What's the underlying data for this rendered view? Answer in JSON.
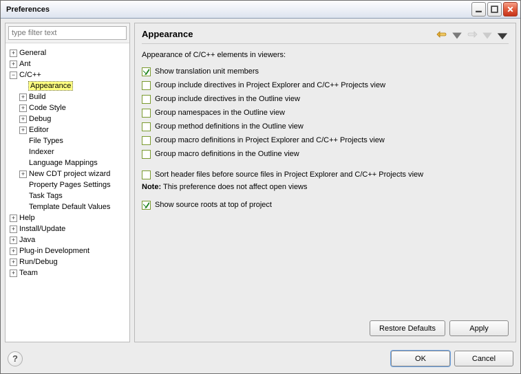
{
  "window": {
    "title": "Preferences"
  },
  "filter": {
    "placeholder": "type filter text"
  },
  "page": {
    "title": "Appearance",
    "description": "Appearance of C/C++ elements in viewers:",
    "noteLabel": "Note:",
    "noteText": "This preference does not affect open views"
  },
  "checkboxes": [
    {
      "label": "Show translation unit members",
      "checked": true
    },
    {
      "label": "Group include directives in Project Explorer and C/C++ Projects view",
      "checked": false
    },
    {
      "label": "Group include directives in the Outline view",
      "checked": false
    },
    {
      "label": "Group namespaces in the Outline view",
      "checked": false
    },
    {
      "label": "Group method definitions in the Outline view",
      "checked": false
    },
    {
      "label": "Group macro definitions in Project Explorer and C/C++ Projects view",
      "checked": false
    },
    {
      "label": "Group macro definitions in the Outline view",
      "checked": false
    }
  ],
  "sortHeader": {
    "label": "Sort header files before source files in Project Explorer and C/C++ Projects view",
    "checked": false
  },
  "showSourceRoots": {
    "label": "Show source roots at top of project",
    "checked": true
  },
  "buttons": {
    "restoreDefaults": "Restore Defaults",
    "apply": "Apply",
    "ok": "OK",
    "cancel": "Cancel",
    "help": "?"
  },
  "tree": {
    "general": "General",
    "ant": "Ant",
    "ccpp": "C/C++",
    "appearance": "Appearance",
    "build": "Build",
    "codeStyle": "Code Style",
    "debug": "Debug",
    "editor": "Editor",
    "fileTypes": "File Types",
    "indexer": "Indexer",
    "languageMappings": "Language Mappings",
    "newCdt": "New CDT project wizard",
    "propertyPages": "Property Pages Settings",
    "taskTags": "Task Tags",
    "templateDefaults": "Template Default Values",
    "help": "Help",
    "installUpdate": "Install/Update",
    "java": "Java",
    "pluginDev": "Plug-in Development",
    "runDebug": "Run/Debug",
    "team": "Team"
  }
}
